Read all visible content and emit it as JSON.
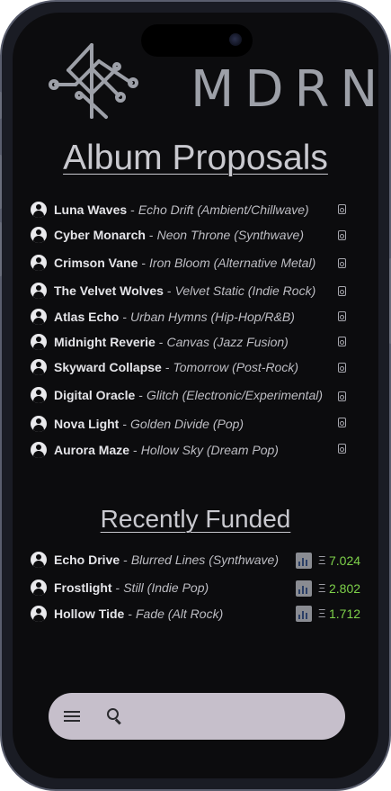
{
  "logo": {
    "text": "MDRN"
  },
  "proposals": {
    "title": "Album Proposals",
    "items": [
      {
        "artist": "Luna Waves",
        "album": "Echo Drift (Ambient/Chillwave)"
      },
      {
        "artist": "Cyber Monarch",
        "album": "Neon Throne (Synthwave)"
      },
      {
        "artist": "Crimson Vane",
        "album": "Iron Bloom (Alternative Metal)"
      },
      {
        "artist": "The Velvet Wolves",
        "album": "Velvet Static (Indie Rock)"
      },
      {
        "artist": "Atlas Echo",
        "album": "Urban Hymns (Hip-Hop/R&B)"
      },
      {
        "artist": "Midnight Reverie",
        "album": "Canvas (Jazz Fusion)"
      },
      {
        "artist": "Skyward Collapse",
        "album": "Tomorrow (Post-Rock)"
      },
      {
        "artist": "Digital Oracle",
        "album": "Glitch (Electronic/Experimental)"
      },
      {
        "artist": "Nova Light",
        "album": "Golden Divide (Pop)"
      },
      {
        "artist": "Aurora Maze",
        "album": "Hollow Sky (Dream Pop)"
      }
    ]
  },
  "funded": {
    "title": "Recently Funded",
    "currency_symbol": "Ξ",
    "items": [
      {
        "artist": "Echo Drive",
        "album": "Blurred Lines (Synthwave)",
        "amount": "7.024"
      },
      {
        "artist": "Frostlight",
        "album": "Still (Indie Pop)",
        "amount": "2.802"
      },
      {
        "artist": "Hollow Tide",
        "album": "Fade (Alt Rock)",
        "amount": "1.712"
      }
    ]
  },
  "separator": "-",
  "icons": {
    "avatar": "user-circle-icon",
    "vote": "ballot-icon",
    "chart": "chart-icon",
    "menu": "hamburger-menu-icon",
    "search": "search-icon"
  },
  "colors": {
    "background": "#0c0c0e",
    "amount": "#7ed14a",
    "navbar": "#c6bfcb",
    "logo": "#9da0a8"
  }
}
